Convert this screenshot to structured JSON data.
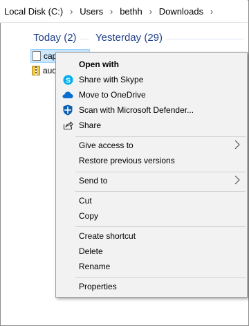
{
  "breadcrumb": [
    "Local Disk (C:)",
    "Users",
    "bethh",
    "Downloads"
  ],
  "groups": {
    "today": "Today (2)",
    "yesterday": "Yesterday (29)"
  },
  "files": [
    {
      "name": "cap",
      "icon": "document-icon",
      "selected": true
    },
    {
      "name": "aud",
      "icon": "zip-folder-icon",
      "selected": false
    }
  ],
  "context_menu": {
    "open_with": "Open with",
    "share_skype": "Share with Skype",
    "move_onedrive": "Move to OneDrive",
    "scan_defender": "Scan with Microsoft Defender...",
    "share": "Share",
    "give_access": "Give access to",
    "restore_versions": "Restore previous versions",
    "send_to": "Send to",
    "cut": "Cut",
    "copy": "Copy",
    "create_shortcut": "Create shortcut",
    "delete": "Delete",
    "rename": "Rename",
    "properties": "Properties"
  },
  "colors": {
    "group_header": "#1e3f8a",
    "skype": "#00aff0",
    "onedrive": "#0a6ed1",
    "defender": "#0a5fb4",
    "menu_bg": "#f2f2f2"
  }
}
